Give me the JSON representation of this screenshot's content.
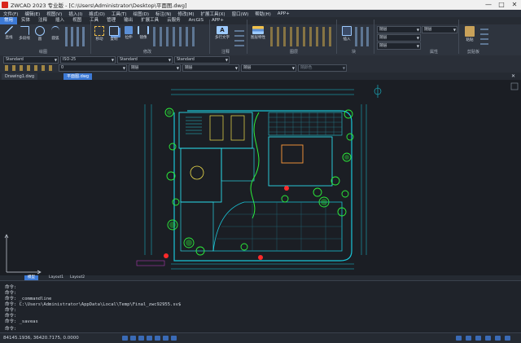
{
  "window": {
    "title": "ZWCAD 2023 专业版 - [C:\\Users\\Administrator\\Desktop\\平面图.dwg]",
    "minimize": "—",
    "maximize": "□",
    "close": "✕"
  },
  "menu": [
    "文件(F)",
    "编辑(E)",
    "视图(V)",
    "插入(I)",
    "格式(O)",
    "工具(T)",
    "绘图(D)",
    "标注(N)",
    "修改(M)",
    "扩展工具(X)",
    "窗口(W)",
    "帮助(H)",
    "APP+"
  ],
  "ribbon_tabs": [
    "常用",
    "实体",
    "注释",
    "插入",
    "视图",
    "工具",
    "管理",
    "输出",
    "扩展工具",
    "云服务",
    "ArcGIS",
    "APP+"
  ],
  "ribbon_groups": {
    "draw": "绘图",
    "modify": "修改",
    "annotate": "注释",
    "layers": "图层",
    "block": "块",
    "properties": "属性",
    "clipboard": "剪贴板"
  },
  "ribbon_buttons": {
    "line": "直线",
    "polyline": "多段线",
    "circle": "圆",
    "arc": "圆弧",
    "move": "移动",
    "copy": "复制",
    "stretch": "拉伸",
    "mirror": "镜像",
    "mtext": "多行文字",
    "layer_props": "图层特性",
    "insert": "插入",
    "paste": "粘贴"
  },
  "props": {
    "text_style": "Standard",
    "dim_style": "ISO-25",
    "table_style": "Standard",
    "mleader_style": "Standard",
    "color": "随层",
    "linetype": "随层",
    "lineweight": "随层",
    "layer": "0",
    "layer_linetype": "随层",
    "layer_lineweight": "随层",
    "plot_style": "随颜色"
  },
  "doc_tabs": [
    "Drawing1.dwg",
    "平面图.dwg"
  ],
  "layout_tabs": [
    "模型",
    "Layout1",
    "Layout2"
  ],
  "command_lines": [
    "命令:",
    "命令:",
    "命令:  _commandline",
    "命令:  C:\\Users\\Administrator\\AppData\\Local\\Temp\\Final_zwc92955.sv$",
    "命令:",
    "命令:",
    "命令:  _saveas",
    "命令:"
  ],
  "status": {
    "coords": "84145.1936, 36420.7175, 0.0000"
  },
  "colors": {
    "accent": "#3d7ad6",
    "background": "#1b1e24",
    "wall_cyan": "#19c6d8",
    "tree_green": "#2cf03a",
    "dim_magenta": "#c83cc8",
    "marker_red": "#ff2a2a"
  }
}
